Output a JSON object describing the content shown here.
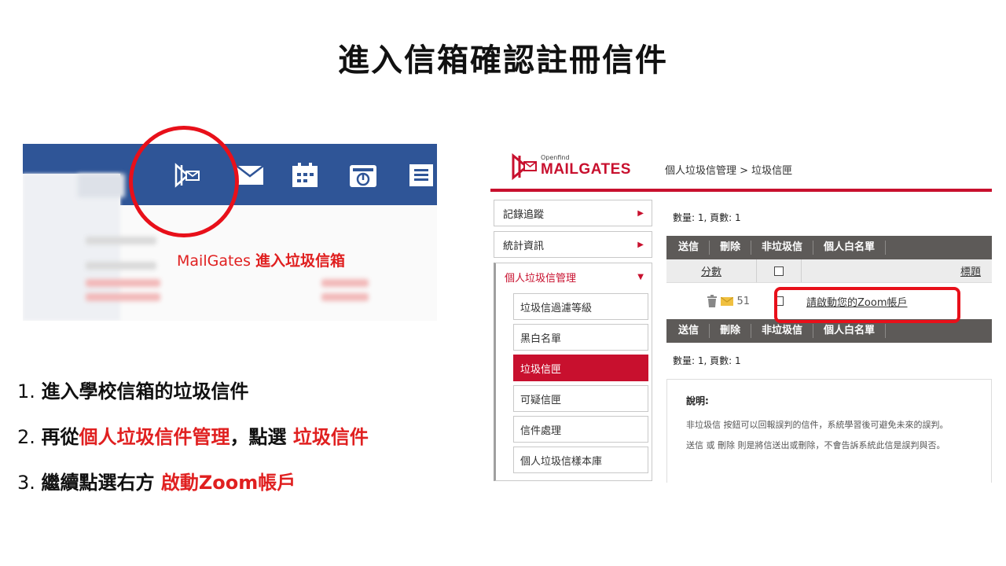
{
  "title": "進入信箱確認註冊信件",
  "left_shot": {
    "label_prefix": "MailGates ",
    "label_main": "進入垃圾信箱"
  },
  "steps": [
    {
      "num": "1. ",
      "text": "進入學校信箱的垃圾信件"
    },
    {
      "num": "2. ",
      "pre": "再從",
      "hl1": "個人垃圾信件管理",
      "mid": "，點選 ",
      "hl2": "垃圾信件"
    },
    {
      "num": "3. ",
      "pre": "繼續點選右方 ",
      "hl": "啟動Zoom帳戶"
    }
  ],
  "right_shot": {
    "logo_small": "Openfind",
    "logo_big": "MAILGATES",
    "breadcrumb": "個人垃圾信管理 > 垃圾信匣",
    "sidebar": {
      "item1": "記錄追蹤",
      "item2": "統計資訊",
      "group": "個人垃圾信管理",
      "sub": [
        "垃圾信過濾等級",
        "黑白名單",
        "垃圾信匣",
        "可疑信匣",
        "信件處理",
        "個人垃圾信樣本庫"
      ]
    },
    "count": "數量: 1, 頁數: 1",
    "toolbar": [
      "送信",
      "刪除",
      "非垃圾信",
      "個人白名單"
    ],
    "headers": {
      "score": "分數",
      "subject": "標題"
    },
    "row": {
      "score": "51",
      "subject": "請啟動您的Zoom帳戶"
    },
    "note": {
      "title": "說明:",
      "line1": "非垃圾信 按鈕可以回報誤判的信件，系統學習後可避免未來的誤判。",
      "line2": "送信 或 刪除 則是將信送出或刪除，不會告訴系統此信是誤判與否。"
    }
  },
  "colors": {
    "accent_red": "#e02020",
    "brand_red": "#c8102e",
    "nav_blue": "#2f5597",
    "toolbar_gray": "#5d5a58"
  }
}
